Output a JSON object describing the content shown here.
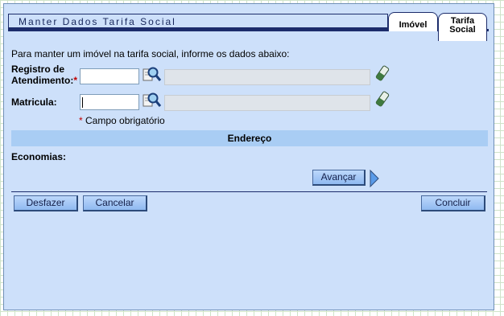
{
  "title": "Manter Dados Tarifa Social",
  "tabs": [
    {
      "label": "Imóvel",
      "active": true
    },
    {
      "label_line1": "Tarifa",
      "label_line2": "Social",
      "active": false
    }
  ],
  "instructions": "Para manter um imóvel na tarifa social, informe os dados abaixo:",
  "fields": {
    "registro_label_line1": "Registro de",
    "registro_label_line2": "Atendimento:",
    "required_mark": "*",
    "registro_value": "",
    "matricula_label": "Matricula:",
    "matricula_value": ""
  },
  "required_note": "* Campo obrigatório",
  "section_header": "Endereço",
  "economias_label": "Economias:",
  "buttons": {
    "avancar": "Avançar",
    "desfazer": "Desfazer",
    "cancelar": "Cancelar",
    "concluir": "Concluir"
  },
  "colors": {
    "panel_bg": "#cde0fa",
    "section_bar": "#a9cdf4",
    "border_dark": "#1c2c6b",
    "required": "#c00000"
  },
  "icons": [
    "search-icon",
    "eraser-icon",
    "next-arrow-icon"
  ]
}
